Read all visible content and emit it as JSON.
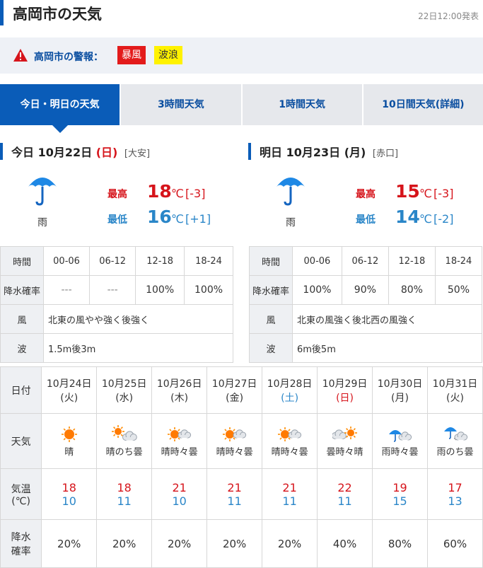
{
  "header": {
    "title": "高岡市の天気",
    "issued": "22日12:00発表"
  },
  "warnings": {
    "label": "高岡市の警報：",
    "items": [
      "暴風",
      "波浪"
    ]
  },
  "tabs": [
    "今日・明日の天気",
    "3時間天気",
    "1時間天気",
    "10日間天気(詳細)"
  ],
  "today": {
    "prefix": "今日 10月22日",
    "weekday_open": "(",
    "weekday": "日",
    "weekday_close": ")",
    "rokuyo": "[大安]",
    "weather": "雨",
    "icon": "umbrella-icon",
    "high_label": "最高",
    "high": "18",
    "high_unit": "℃",
    "high_diff": "[-3]",
    "low_label": "最低",
    "low": "16",
    "low_unit": "℃",
    "low_diff": "[+1]",
    "table": {
      "time_label": "時間",
      "times": [
        "00-06",
        "06-12",
        "12-18",
        "18-24"
      ],
      "precip_label": "降水確率",
      "precip": [
        "---",
        "---",
        "100%",
        "100%"
      ],
      "wind_label": "風",
      "wind": "北東の風やや強く後強く",
      "wave_label": "波",
      "wave": "1.5m後3m"
    }
  },
  "tomorrow": {
    "prefix": "明日 10月23日",
    "weekday_open": "(",
    "weekday": "月",
    "weekday_close": ")",
    "rokuyo": "[赤口]",
    "weather": "雨",
    "icon": "umbrella-icon",
    "high_label": "最高",
    "high": "15",
    "high_unit": "℃",
    "high_diff": "[-3]",
    "low_label": "最低",
    "low": "14",
    "low_unit": "℃",
    "low_diff": "[-2]",
    "table": {
      "time_label": "時間",
      "times": [
        "00-06",
        "06-12",
        "12-18",
        "18-24"
      ],
      "precip_label": "降水確率",
      "precip": [
        "100%",
        "90%",
        "80%",
        "50%"
      ],
      "wind_label": "風",
      "wind": "北東の風強く後北西の風強く",
      "wave_label": "波",
      "wave": "6m後5m"
    }
  },
  "weekly": {
    "date_label": "日付",
    "weather_label": "天気",
    "temp_label_1": "気温",
    "temp_label_2": "(℃)",
    "precip_label_1": "降水",
    "precip_label_2": "確率",
    "days": [
      {
        "date": "10月24日",
        "wd": "(火)",
        "wd_type": "weekday",
        "icon": "sun-icon",
        "weather": "晴",
        "high": "18",
        "low": "10",
        "precip": "20%"
      },
      {
        "date": "10月25日",
        "wd": "(水)",
        "wd_type": "weekday",
        "icon": "sun-then-cloud-icon",
        "weather": "晴のち曇",
        "high": "18",
        "low": "11",
        "precip": "20%"
      },
      {
        "date": "10月26日",
        "wd": "(木)",
        "wd_type": "weekday",
        "icon": "sun-sometimes-cloud-icon",
        "weather": "晴時々曇",
        "high": "21",
        "low": "10",
        "precip": "20%"
      },
      {
        "date": "10月27日",
        "wd": "(金)",
        "wd_type": "weekday",
        "icon": "sun-sometimes-cloud-icon",
        "weather": "晴時々曇",
        "high": "21",
        "low": "11",
        "precip": "20%"
      },
      {
        "date": "10月28日",
        "wd": "(土)",
        "wd_type": "sat",
        "icon": "sun-sometimes-cloud-icon",
        "weather": "晴時々曇",
        "high": "21",
        "low": "11",
        "precip": "20%"
      },
      {
        "date": "10月29日",
        "wd": "(日)",
        "wd_type": "sun",
        "icon": "cloud-sometimes-sun-icon",
        "weather": "曇時々晴",
        "high": "22",
        "low": "11",
        "precip": "40%"
      },
      {
        "date": "10月30日",
        "wd": "(月)",
        "wd_type": "weekday",
        "icon": "rain-sometimes-cloud-icon",
        "weather": "雨時々曇",
        "high": "19",
        "low": "15",
        "precip": "80%"
      },
      {
        "date": "10月31日",
        "wd": "(火)",
        "wd_type": "weekday",
        "icon": "rain-then-cloud-icon",
        "weather": "雨のち曇",
        "high": "17",
        "low": "13",
        "precip": "60%"
      }
    ]
  },
  "colors": {
    "accent": "#0a5cb8",
    "high": "#d6141b",
    "low": "#2a86c8",
    "storm": "#e31b1b",
    "wave": "#fff200"
  }
}
